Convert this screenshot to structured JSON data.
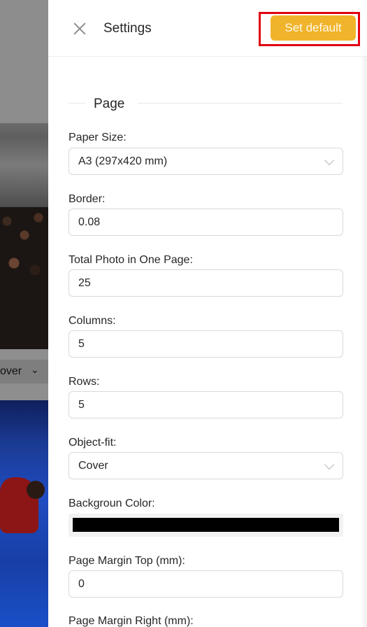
{
  "background": {
    "select_value": "over"
  },
  "drawer": {
    "title": "Settings",
    "set_default_label": "Set default",
    "section_title": "Page",
    "fields": {
      "paper_size": {
        "label": "Paper Size:",
        "value": "A3 (297x420 mm)"
      },
      "border": {
        "label": "Border:",
        "value": "0.08"
      },
      "total_photo": {
        "label": "Total Photo in One Page:",
        "value": "25"
      },
      "columns": {
        "label": "Columns:",
        "value": "5"
      },
      "rows": {
        "label": "Rows:",
        "value": "5"
      },
      "object_fit": {
        "label": "Object-fit:",
        "value": "Cover"
      },
      "background_color": {
        "label": "Backgroun Color:",
        "value": "#000000"
      },
      "margin_top": {
        "label": "Page Margin Top (mm):",
        "value": "0"
      },
      "margin_right": {
        "label": "Page Margin Right (mm):"
      }
    }
  },
  "colors": {
    "accent": "#f0b42c",
    "highlight_border": "#e00012"
  }
}
